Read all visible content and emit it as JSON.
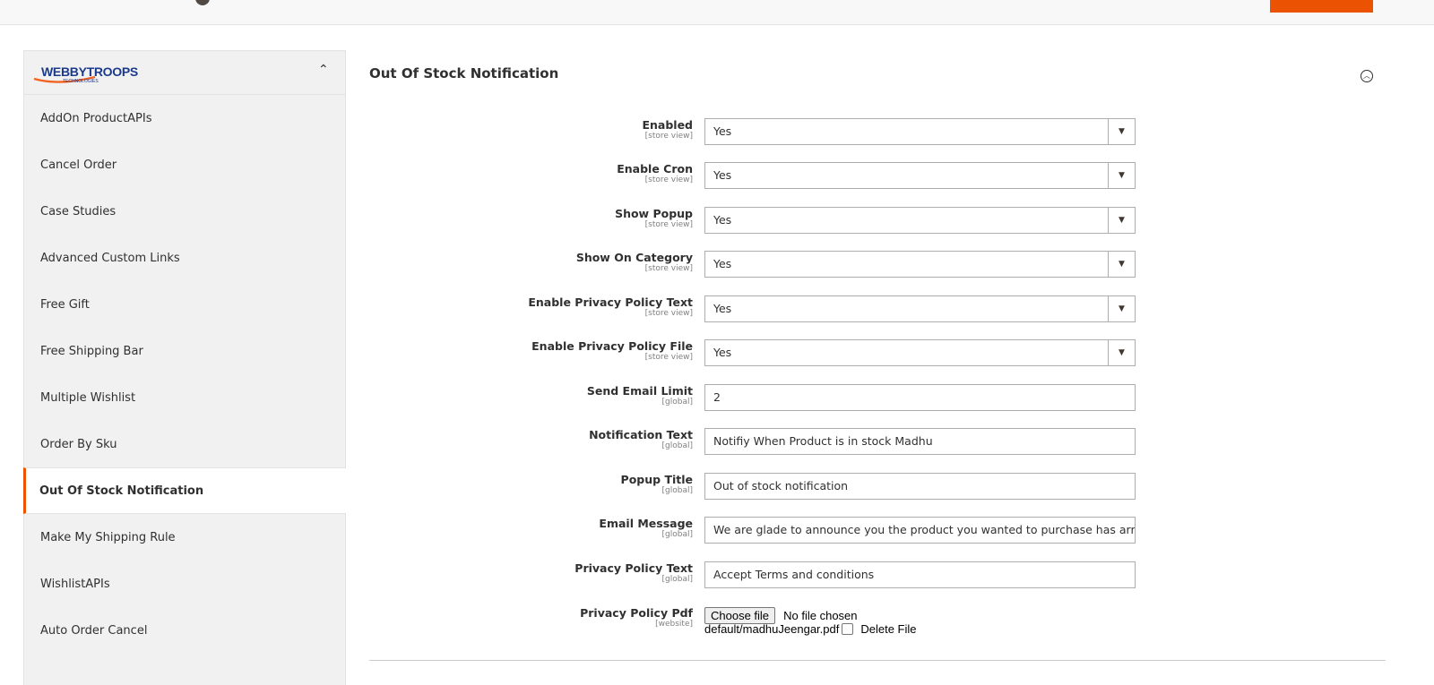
{
  "sidebar": {
    "logo_text": "WEBBYTROOPS",
    "logo_subtext": "TECHNOLOGIES",
    "items": [
      {
        "label": "AddOn ProductAPIs",
        "active": false
      },
      {
        "label": "Cancel Order",
        "active": false
      },
      {
        "label": "Case Studies",
        "active": false
      },
      {
        "label": "Advanced Custom Links",
        "active": false
      },
      {
        "label": "Free Gift",
        "active": false
      },
      {
        "label": "Free Shipping Bar",
        "active": false
      },
      {
        "label": "Multiple Wishlist",
        "active": false
      },
      {
        "label": "Order By Sku",
        "active": false
      },
      {
        "label": "Out Of Stock Notification",
        "active": true
      },
      {
        "label": "Make My Shipping Rule",
        "active": false
      },
      {
        "label": "WishlistAPIs",
        "active": false
      },
      {
        "label": "Auto Order Cancel",
        "active": false
      }
    ]
  },
  "section": {
    "title": "Out Of Stock Notification"
  },
  "fields": {
    "enabled": {
      "label": "Enabled",
      "scope": "[store view]",
      "value": "Yes"
    },
    "enable_cron": {
      "label": "Enable Cron",
      "scope": "[store view]",
      "value": "Yes"
    },
    "show_popup": {
      "label": "Show Popup",
      "scope": "[store view]",
      "value": "Yes"
    },
    "show_on_category": {
      "label": "Show On Category",
      "scope": "[store view]",
      "value": "Yes"
    },
    "enable_privacy_text": {
      "label": "Enable Privacy Policy Text",
      "scope": "[store view]",
      "value": "Yes"
    },
    "enable_privacy_file": {
      "label": "Enable Privacy Policy File",
      "scope": "[store view]",
      "value": "Yes"
    },
    "send_email_limit": {
      "label": "Send Email Limit",
      "scope": "[global]",
      "value": "2"
    },
    "notification_text": {
      "label": "Notification Text",
      "scope": "[global]",
      "value": "Notifiy When Product is in stock Madhu"
    },
    "popup_title": {
      "label": "Popup Title",
      "scope": "[global]",
      "value": "Out of stock notification"
    },
    "email_message": {
      "label": "Email Message",
      "scope": "[global]",
      "value": "We are glade to announce you the product you wanted to purchase has arrived"
    },
    "privacy_policy_text": {
      "label": "Privacy Policy Text",
      "scope": "[global]",
      "value": "Accept Terms and conditions"
    },
    "privacy_policy_pdf": {
      "label": "Privacy Policy Pdf",
      "scope": "[website]",
      "button_label": "Choose file",
      "status": "No file chosen",
      "current_file": "default/madhuJeengar.pdf",
      "delete_label": "Delete File"
    }
  },
  "colors": {
    "accent": "#eb5202",
    "sidebar_bg": "#f1f1f1",
    "border": "#adadad"
  }
}
